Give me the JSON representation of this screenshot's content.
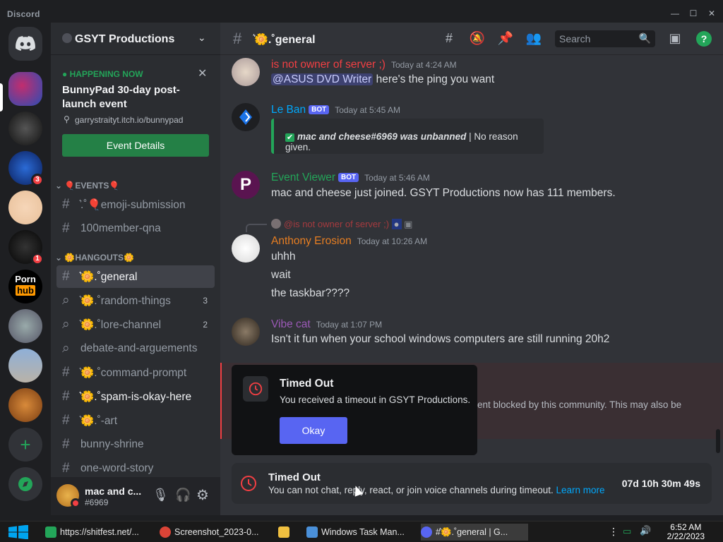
{
  "window": {
    "app_name": "Discord"
  },
  "server": {
    "name": "GSYT Productions",
    "event": {
      "status": "HAPPENING NOW",
      "title": "BunnyPad 30-day post-launch event",
      "link": "garrystraityt.itch.io/bunnypad",
      "button": "Event Details"
    },
    "categories": [
      {
        "label": "🎈EVENTS🎈",
        "channels": [
          {
            "name": "͛.˚🎈emoji-submission",
            "type": "text"
          },
          {
            "name": "100member-qna",
            "type": "text"
          }
        ]
      },
      {
        "label": "🌼HANGOUTS🌼",
        "channels": [
          {
            "name": "͛🌼.˚general",
            "type": "text",
            "active": true
          },
          {
            "name": "͛🌼.˚random-things",
            "type": "thread",
            "count": "3"
          },
          {
            "name": "͛🌼.˚lore-channel",
            "type": "thread",
            "count": "2"
          },
          {
            "name": "debate-and-arguements",
            "type": "thread"
          },
          {
            "name": "͛🌼.˚command-prompt",
            "type": "text"
          },
          {
            "name": "͛🌼.˚spam-is-okay-here",
            "type": "text",
            "bright": true
          },
          {
            "name": "͛🌼.˚-art",
            "type": "text"
          },
          {
            "name": "bunny-shrine",
            "type": "text"
          },
          {
            "name": "one-word-story",
            "type": "text"
          }
        ]
      }
    ]
  },
  "rail": {
    "badges": [
      "3",
      "1"
    ]
  },
  "user": {
    "name": "mac and c...",
    "tag": "#6969"
  },
  "channel_header": {
    "title": "͛🌼.˚general",
    "search_placeholder": "Search"
  },
  "messages": [
    {
      "author": "is not owner of server ;)",
      "color": "#f23f43",
      "timestamp": "Today at 4:24 AM",
      "mention": "@ASUS DVD Writer",
      "text": " here's the ping you want"
    },
    {
      "author": "Le Ban",
      "color": "#00a8fc",
      "bot": "BOT",
      "timestamp": "Today at 5:45 AM",
      "embed_bold": "mac and cheese#6969 was unbanned",
      "embed_rest": " | No reason given."
    },
    {
      "author": "Event Viewer",
      "color": "#23a559",
      "bot": "BOT",
      "timestamp": "Today at 5:46 AM",
      "text": "mac and cheese just joined. GSYT Productions now has 111 members."
    },
    {
      "reply_to": "@is not owner of server ;)",
      "author": "Anthony Erosion",
      "color": "#e67e22",
      "timestamp": "Today at 10:26 AM",
      "lines": [
        "uhhh",
        "wait",
        "the taskbar????"
      ]
    },
    {
      "author": "Vibe cat",
      "color": "#9b59b6",
      "timestamp": "Today at 1:07 PM",
      "text": "Isn't it fun when your school windows computers are still running 20h2"
    }
  ],
  "blocked_notice": "ent blocked by this community. This may also be",
  "modal": {
    "title": "Timed Out",
    "body": "You received a timeout in GSYT Productions.",
    "button": "Okay"
  },
  "timeout_bar": {
    "title": "Timed Out",
    "desc": "You can not chat, reply, react, or join voice channels during timeout.",
    "link": "Learn more",
    "timer": "07d 10h 30m 49s"
  },
  "taskbar": {
    "items": [
      {
        "label": "https://shitfest.net/...",
        "color": "#23a559"
      },
      {
        "label": "Screenshot_2023-0...",
        "color": "#db4437"
      },
      {
        "label": "",
        "color": "#f0c040"
      },
      {
        "label": "Windows Task Man...",
        "color": "#4a90d9"
      },
      {
        "label": "#͛🌼.˚general | G...",
        "color": "#5865f2"
      }
    ],
    "time": "6:52 AM",
    "date": "2/22/2023"
  }
}
